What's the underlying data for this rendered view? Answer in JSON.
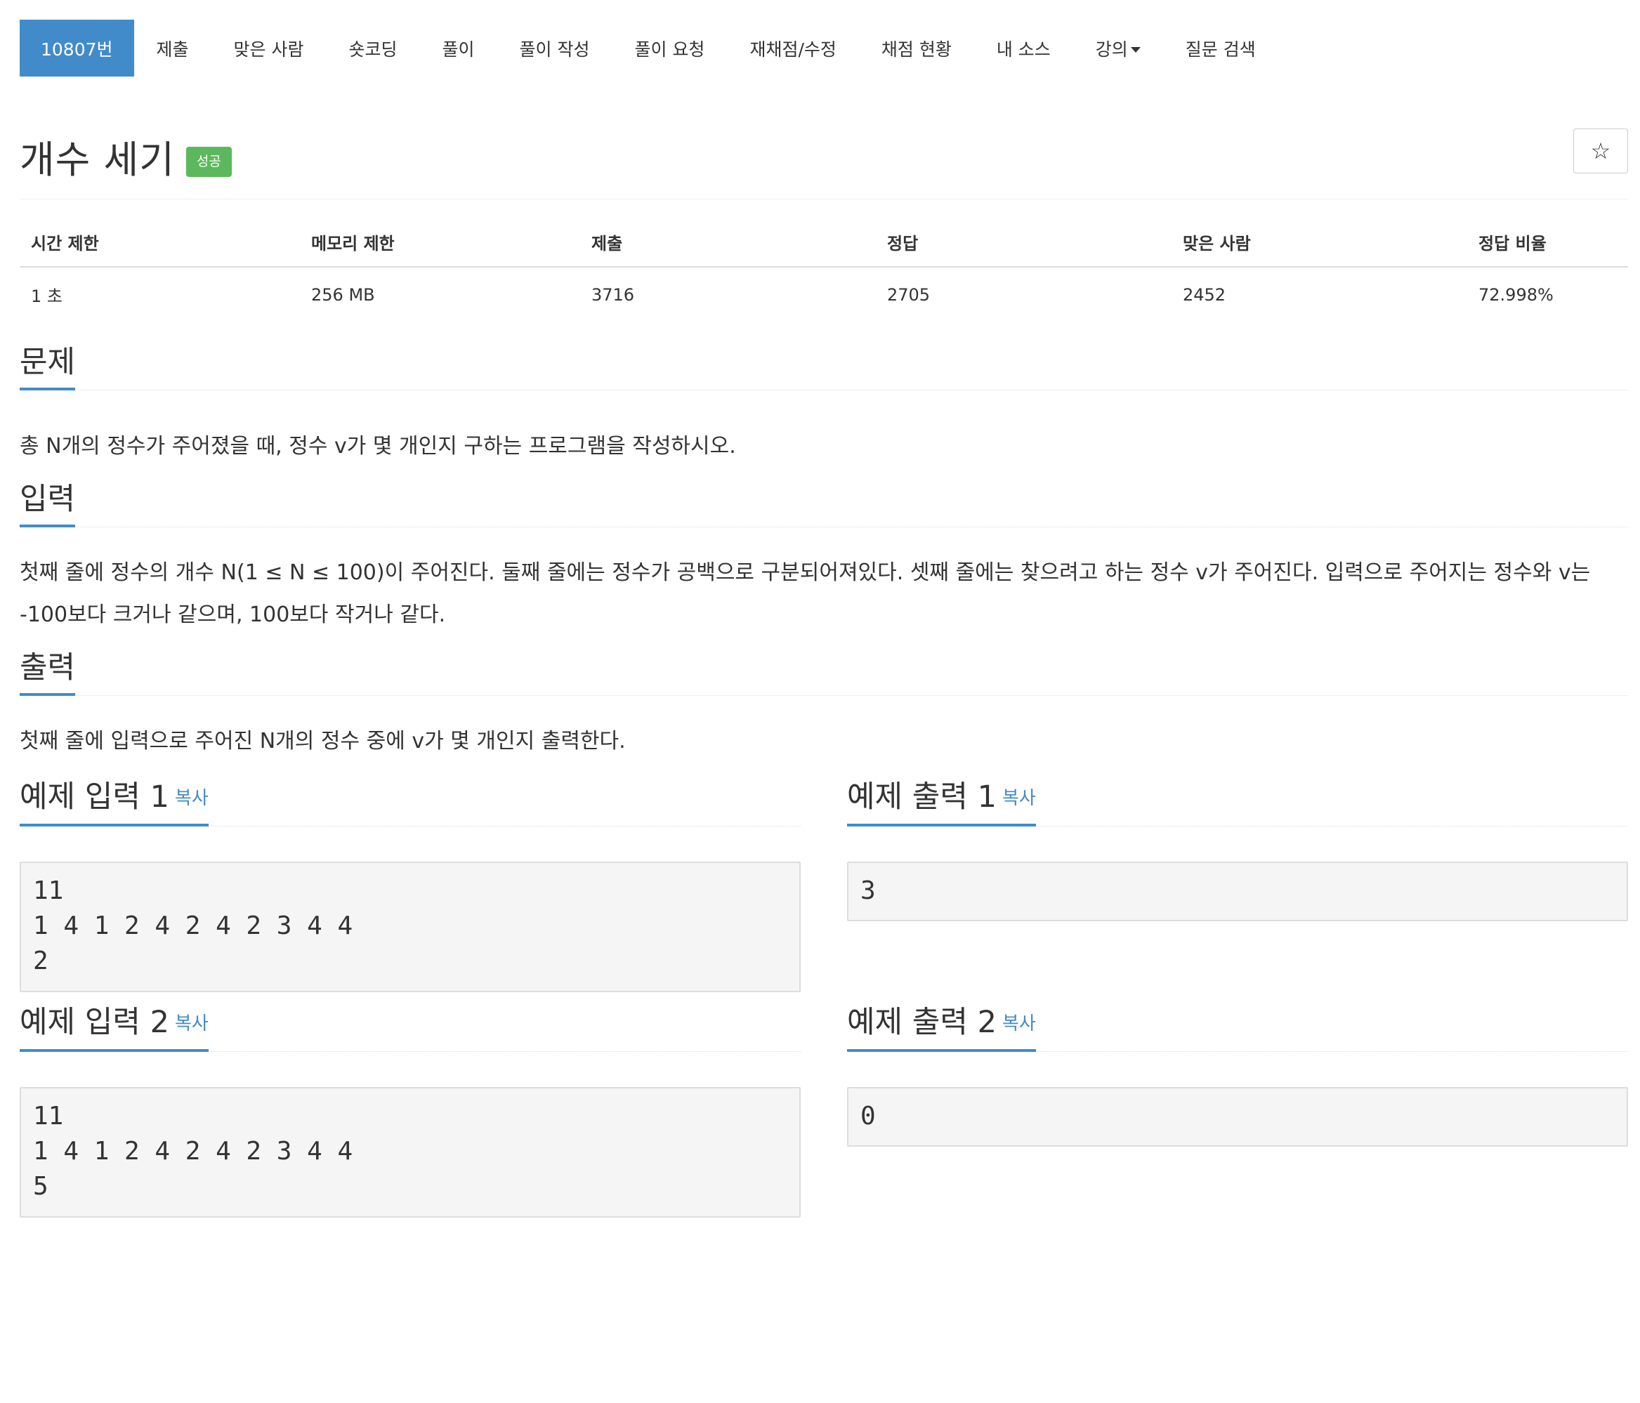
{
  "nav": {
    "items": [
      {
        "label": "10807번",
        "active": true
      },
      {
        "label": "제출"
      },
      {
        "label": "맞은 사람"
      },
      {
        "label": "숏코딩"
      },
      {
        "label": "풀이"
      },
      {
        "label": "풀이 작성"
      },
      {
        "label": "풀이 요청"
      },
      {
        "label": "재채점/수정"
      },
      {
        "label": "채점 현황"
      },
      {
        "label": "내 소스"
      },
      {
        "label": "강의",
        "dropdown": true
      },
      {
        "label": "질문 검색"
      }
    ]
  },
  "problem": {
    "title": "개수 세기",
    "status_badge": "성공",
    "star_icon": "☆"
  },
  "info": {
    "headers": [
      "시간 제한",
      "메모리 제한",
      "제출",
      "정답",
      "맞은 사람",
      "정답 비율"
    ],
    "values": [
      "1 초",
      "256 MB",
      "3716",
      "2705",
      "2452",
      "72.998%"
    ]
  },
  "sections": {
    "problem": {
      "title": "문제",
      "body": "총 N개의 정수가 주어졌을 때, 정수 v가 몇 개인지 구하는 프로그램을 작성하시오."
    },
    "input": {
      "title": "입력",
      "body": "첫째 줄에 정수의 개수 N(1 ≤ N ≤ 100)이 주어진다. 둘째 줄에는 정수가 공백으로 구분되어져있다. 셋째 줄에는 찾으려고 하는 정수 v가 주어진다. 입력으로 주어지는 정수와 v는 -100보다 크거나 같으며, 100보다 작거나 같다."
    },
    "output": {
      "title": "출력",
      "body": "첫째 줄에 입력으로 주어진 N개의 정수 중에 v가 몇 개인지 출력한다."
    }
  },
  "samples": {
    "copy_label": "복사",
    "input1": {
      "title": "예제 입력 1",
      "content": "11\n1 4 1 2 4 2 4 2 3 4 4\n2"
    },
    "output1": {
      "title": "예제 출력 1",
      "content": "3"
    },
    "input2": {
      "title": "예제 입력 2",
      "content": "11\n1 4 1 2 4 2 4 2 3 4 4\n5"
    },
    "output2": {
      "title": "예제 출력 2",
      "content": "0"
    }
  },
  "colors": {
    "accent": "#428bca",
    "success": "#5cb85c"
  }
}
